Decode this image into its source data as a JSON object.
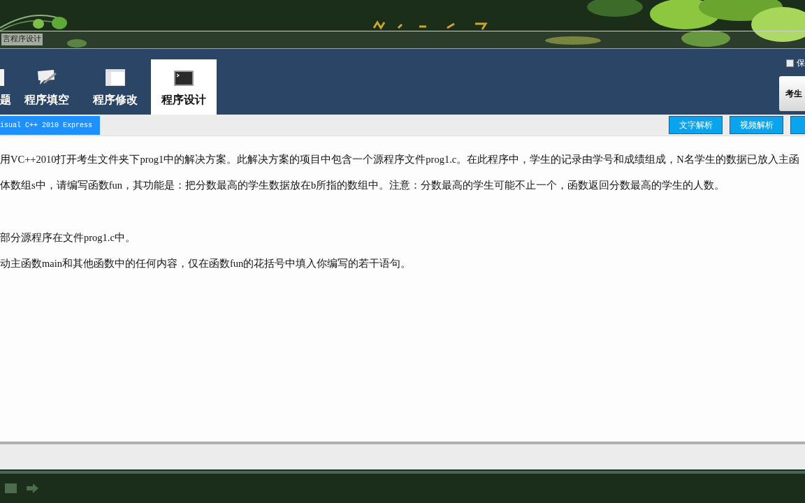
{
  "header": {
    "title": "言程序设计"
  },
  "tabs": [
    {
      "label": "题",
      "kind": "document",
      "selected": false
    },
    {
      "label": "程序填空",
      "kind": "pencil",
      "selected": false
    },
    {
      "label": "程序修改",
      "kind": "window",
      "selected": false
    },
    {
      "label": "程序设计",
      "kind": "terminal",
      "selected": true
    }
  ],
  "keep_option": {
    "label": "保",
    "checked": false
  },
  "side_button": {
    "label": "考生"
  },
  "subbar": {
    "environment": "isual C++ 2010 Express",
    "buttons": [
      "文字解析",
      "视频解析"
    ]
  },
  "question": {
    "blocks": [
      {
        "lines": [
          "用VC++2010打开考生文件夹下prog1中的解决方案。此解决方案的项目中包含一个源程序文件prog1.c。在此程序中，学生的记录由学号和成绩组成，N名学生的数据已放入主函",
          "体数组s中，请编写函数fun，其功能是：把分数最高的学生数据放在b所指的数组中。注意：分数最高的学生可能不止一个，函数返回分数最高的学生的人数。"
        ]
      },
      {
        "lines": [
          "部分源程序在文件prog1.c中。",
          "动主函数main和其他函数中的任何内容，仅在函数fun的花括号中填入你编写的若干语句。"
        ]
      }
    ]
  }
}
